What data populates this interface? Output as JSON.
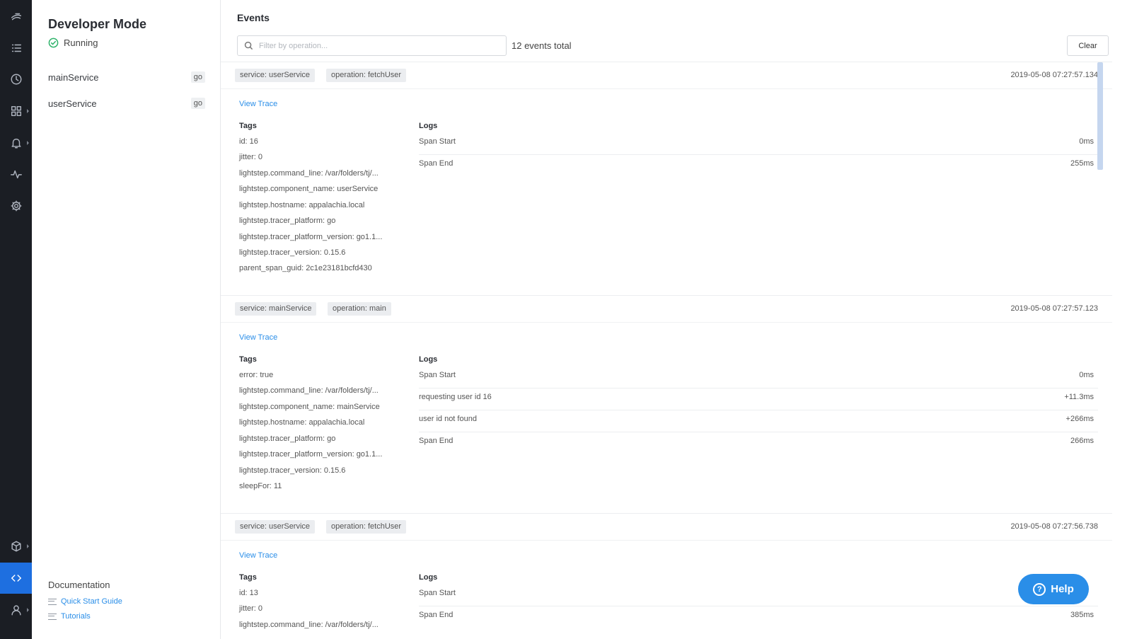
{
  "sidebar": {
    "title": "Developer Mode",
    "status": "Running",
    "services": [
      {
        "name": "mainService",
        "lang": "go"
      },
      {
        "name": "userService",
        "lang": "go"
      }
    ],
    "docs": {
      "title": "Documentation",
      "links": [
        "Quick Start Guide",
        "Tutorials"
      ]
    }
  },
  "main": {
    "title": "Events",
    "filter_placeholder": "Filter by operation...",
    "count": "12 events total",
    "clear_label": "Clear",
    "view_trace_label": "View Trace",
    "tags_label": "Tags",
    "logs_label": "Logs",
    "events": [
      {
        "service": "service: userService",
        "operation": "operation: fetchUser",
        "time": "2019-05-08 07:27:57.134",
        "tags": [
          "id: 16",
          "jitter: 0",
          "lightstep.command_line: /var/folders/tj/...",
          "lightstep.component_name: userService",
          "lightstep.hostname: appalachia.local",
          "lightstep.tracer_platform: go",
          "lightstep.tracer_platform_version: go1.1...",
          "lightstep.tracer_version: 0.15.6",
          "parent_span_guid: 2c1e23181bcfd430"
        ],
        "logs": [
          {
            "text": "Span Start",
            "value": "0ms"
          },
          {
            "text": "Span End",
            "value": "255ms"
          }
        ]
      },
      {
        "service": "service: mainService",
        "operation": "operation: main",
        "time": "2019-05-08 07:27:57.123",
        "tags": [
          "error: true",
          "lightstep.command_line: /var/folders/tj/...",
          "lightstep.component_name: mainService",
          "lightstep.hostname: appalachia.local",
          "lightstep.tracer_platform: go",
          "lightstep.tracer_platform_version: go1.1...",
          "lightstep.tracer_version: 0.15.6",
          "sleepFor: 11"
        ],
        "logs": [
          {
            "text": "Span Start",
            "value": "0ms"
          },
          {
            "text": "requesting user id 16",
            "value": "+11.3ms"
          },
          {
            "text": "user id not found",
            "value": "+266ms"
          },
          {
            "text": "Span End",
            "value": "266ms"
          }
        ]
      },
      {
        "service": "service: userService",
        "operation": "operation: fetchUser",
        "time": "2019-05-08 07:27:56.738",
        "tags": [
          "id: 13",
          "jitter: 0",
          "lightstep.command_line: /var/folders/tj/..."
        ],
        "logs": [
          {
            "text": "Span Start",
            "value": ""
          },
          {
            "text": "Span End",
            "value": "385ms"
          }
        ]
      }
    ]
  },
  "help_label": "Help",
  "colors": {
    "rail": "#1b1e24",
    "accent": "#1e6fe0",
    "link": "#2a8ee8",
    "running": "#2fb36b"
  }
}
